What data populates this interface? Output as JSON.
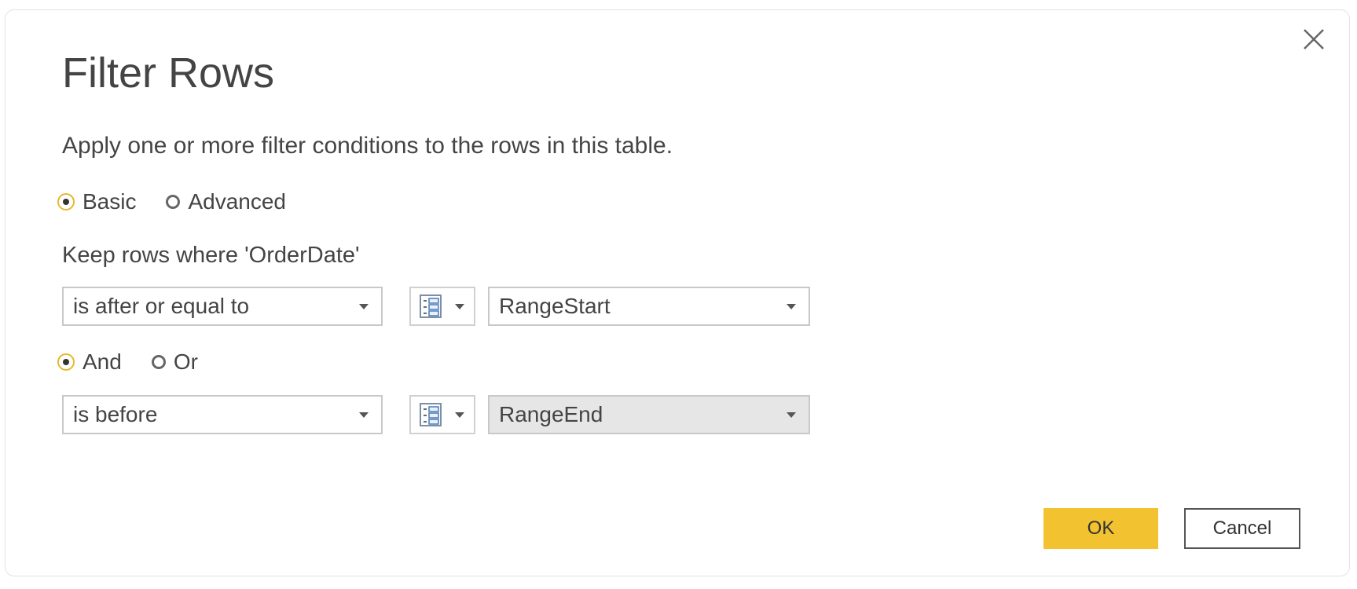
{
  "dialog": {
    "title": "Filter Rows",
    "description": "Apply one or more filter conditions to the rows in this table.",
    "close_icon": "close-icon"
  },
  "mode": {
    "options": [
      {
        "label": "Basic",
        "selected": true
      },
      {
        "label": "Advanced",
        "selected": false
      }
    ]
  },
  "keep_label": "Keep rows where 'OrderDate'",
  "conditions": [
    {
      "operator": "is after or equal to",
      "type_icon": "parameter-list-icon",
      "value": "RangeStart"
    },
    {
      "operator": "is before",
      "type_icon": "parameter-list-icon",
      "value": "RangeEnd"
    }
  ],
  "logic": {
    "options": [
      {
        "label": "And",
        "selected": true
      },
      {
        "label": "Or",
        "selected": false
      }
    ]
  },
  "buttons": {
    "ok_label": "OK",
    "cancel_label": "Cancel"
  },
  "colors": {
    "accent": "#f2c231",
    "radio_checked_ring": "#e8b830",
    "text": "#444444"
  }
}
